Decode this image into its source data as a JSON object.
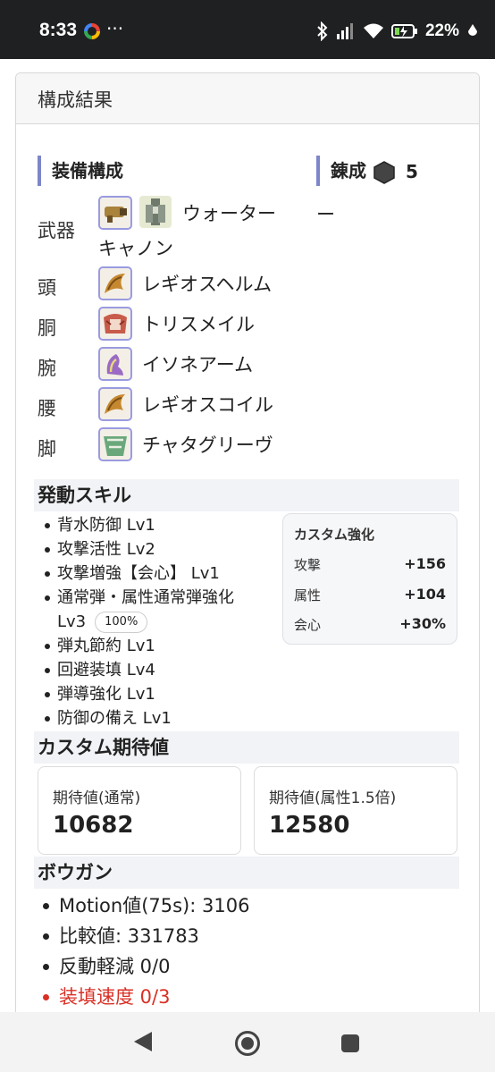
{
  "status_bar": {
    "time": "8:33",
    "more": "···",
    "battery_pct": "22%"
  },
  "card": {
    "header": "構成結果"
  },
  "equipment": {
    "title": "装備構成",
    "items": [
      {
        "label": "武器",
        "name_line1": "ウォーター",
        "name_line2": "キャノン"
      },
      {
        "label": "頭",
        "name": "レギオスヘルム"
      },
      {
        "label": "胴",
        "name": "トリスメイル"
      },
      {
        "label": "腕",
        "name": "イソネアーム"
      },
      {
        "label": "腰",
        "name": "レギオスコイル"
      },
      {
        "label": "脚",
        "name": "チャタグリーヴ"
      }
    ]
  },
  "refine": {
    "title": "錬成",
    "count": "5",
    "value": "ー"
  },
  "skills": {
    "title": "発動スキル",
    "items": [
      "背水防御 Lv1",
      "攻撃活性 Lv2",
      "攻撃増強【会心】 Lv1",
      "通常弾・属性通常弾強化",
      "弾丸節約 Lv1",
      "回避装填 Lv4",
      "弾導強化 Lv1",
      "防御の備え Lv1"
    ],
    "item4_cont": "Lv3",
    "item4_pct": "100%"
  },
  "custom": {
    "title": "カスタム強化",
    "rows": [
      {
        "label": "攻撃",
        "value": "+156"
      },
      {
        "label": "属性",
        "value": "+104"
      },
      {
        "label": "会心",
        "value": "+30%"
      }
    ]
  },
  "expect": {
    "title": "カスタム期待値",
    "normal_label": "期待値(通常)",
    "normal_value": "10682",
    "element_label": "期待値(属性1.5倍)",
    "element_value": "12580"
  },
  "bowgun": {
    "title": "ボウガン",
    "items": [
      "Motion値(75s): 3106",
      "比較値: 331783",
      "反動軽減 0/0",
      "装填速度 0/3"
    ]
  }
}
